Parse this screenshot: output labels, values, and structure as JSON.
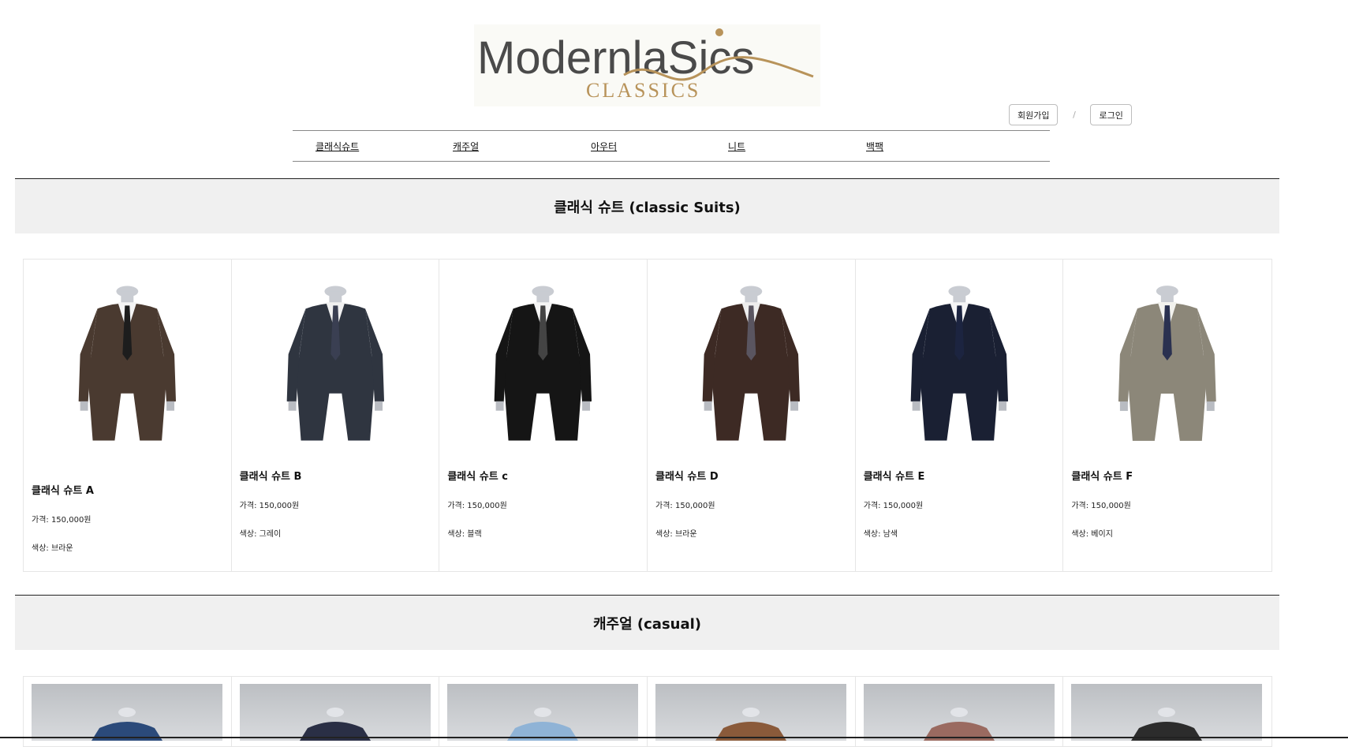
{
  "logo": {
    "wordmark": "ModernlaSics",
    "tagline": "CLASSICS"
  },
  "auth": {
    "signup": "회원가입",
    "separator": "/",
    "login": "로그인"
  },
  "nav": {
    "items": [
      {
        "label": "클래식슈트"
      },
      {
        "label": "캐주얼"
      },
      {
        "label": "아우터"
      },
      {
        "label": "니트"
      },
      {
        "label": "백팩"
      }
    ]
  },
  "sections": [
    {
      "title": "클래식 슈트 (classic Suits)",
      "products": [
        {
          "name": "클래식 슈트 A",
          "price": "가격: 150,000원",
          "color": "색상: 브라운",
          "suit_color": "#4a3a30",
          "shirt": "#f4f4f4",
          "tie": "#1d1d1d"
        },
        {
          "name": "클래식 슈트 B",
          "price": "가격: 150,000원",
          "color": "색상: 그레이",
          "suit_color": "#2f3540",
          "shirt": "#f0f0f0",
          "tie": "#3a3f52"
        },
        {
          "name": "클래식 슈트 c",
          "price": "가격: 150,000원",
          "color": "색상: 블랙",
          "suit_color": "#151515",
          "shirt": "#f5f5f5",
          "tie": "#444"
        },
        {
          "name": "클래식 슈트 D",
          "price": "가격: 150,000원",
          "color": "색상: 브라운",
          "suit_color": "#3d2a24",
          "shirt": "#eeeeee",
          "tie": "#5a5560"
        },
        {
          "name": "클래식 슈트 E",
          "price": "가격: 150,000원",
          "color": "색상: 남색",
          "suit_color": "#1a2033",
          "shirt": "#f5f5f5",
          "tie": "#1c2440"
        },
        {
          "name": "클래식 슈트 F",
          "price": "가격: 150,000원",
          "color": "색상: 베이지",
          "suit_color": "#8c8779",
          "shirt": "#f2f2ee",
          "tie": "#2a3150"
        }
      ]
    },
    {
      "title": "캐주얼 (casual)",
      "products": [
        {
          "garment_color": "#2b4a7a"
        },
        {
          "garment_color": "#2a2f45"
        },
        {
          "garment_color": "#8fb3d6"
        },
        {
          "garment_color": "#8a5a3a"
        },
        {
          "garment_color": "#9a6a60"
        },
        {
          "garment_color": "#2c2c2c"
        }
      ]
    }
  ],
  "colors": {
    "section_bg": "#f0f0f0",
    "logo_dark": "#4a4a4a",
    "logo_gold": "#b8935a"
  }
}
